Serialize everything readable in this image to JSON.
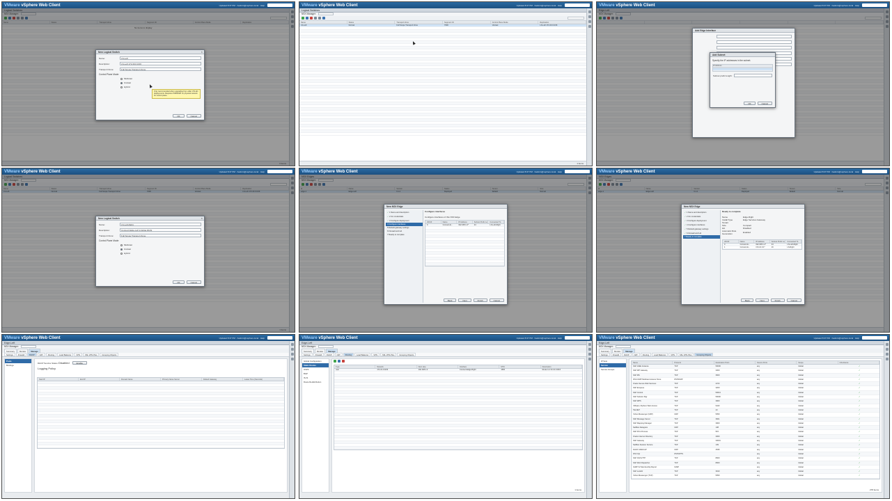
{
  "app": {
    "brand_prefix": "VMware",
    "brand": "vSphere Web Client",
    "topright": "Updated 8:37 PM  ·  hadmin@vsphere.local  ·  Help",
    "nsx_manager_label": "NSX Manager:"
  },
  "panel1": {
    "breadcrumb": "Logical Switches",
    "columns": [
      "Name",
      "Status",
      "Transport Zone",
      "Segment ID",
      "Control Plane Mode",
      "Replication"
    ],
    "empty_text": "No items to display",
    "footer": "0 items",
    "dialog": {
      "title": "New Logical Switch",
      "name_label": "Name:",
      "name_value": "LS-Left",
      "desc_label": "Description:",
      "desc_value": "LS-Left 172.20.0.0/16",
      "tz_label": "Transport Zone:",
      "tz_value": "Full Scope Transport Zone",
      "cpm_label": "Control Plane Mode:",
      "options": [
        "Multicast",
        "Unicast",
        "Hybrid"
      ],
      "tooltip": "Only recommended when upgrading from older VXLAN deployments. Requires PIM/IGMP on physical network for control plane.",
      "ok": "OK",
      "cancel": "Cancel"
    }
  },
  "panel2": {
    "breadcrumb": "Logical Switches",
    "columns": [
      "Name",
      "Status",
      "Transport Zone",
      "Segment ID",
      "Control Plane Mode",
      "Replication"
    ],
    "rows": [
      [
        "LS-Left",
        "Normal",
        "Full Scope Transport Zone",
        "7000",
        "Unicast",
        "LS-Left 172.20.0.0/16"
      ]
    ],
    "footer": "1 items"
  },
  "panel3": {
    "dialog_title": "Add Edge Interface",
    "inner_title": "Add Subnet",
    "inner_text": "Specify the IP addresses in the subnet.",
    "ip_header": "IP Address",
    "ok": "OK",
    "cancel": "Cancel",
    "prefix_label": "Subnet prefix length:",
    "options_text": "Connect Proxy ARP   Send ICMP Redirect"
  },
  "panel4": {
    "breadcrumb": "Logical Switches",
    "rows": [
      [
        "LS-Left",
        "Normal",
        "Full Scope Transport Zone",
        "7000",
        "Unicast",
        "LS-Left 172.20.0.0/16"
      ]
    ],
    "dialog": {
      "title": "New Logical Switch",
      "name_label": "Name:",
      "name_value": "LS-Left-Right",
      "desc_label": "Description:",
      "desc_value": "Connect Edge-Left to Edge-Right",
      "tz_label": "Transport Zone:",
      "tz_value": "Full Scope Transport Zone",
      "cpm_label": "Control Plane Mode:",
      "ok": "OK",
      "cancel": "Cancel"
    },
    "footer": "1 items"
  },
  "panel5": {
    "breadcrumb": "NSX Edges",
    "row": [
      "edge-1",
      "Edge-Left",
      "6.1.2",
      "Deployed",
      "Default",
      "Normal"
    ],
    "wizard_title": "New NSX Edge",
    "steps": [
      "1 Name and description",
      "2 CLI credentials",
      "3 Configure deployment",
      "4 Configure interfaces",
      "5 Default gateway settings",
      "6 Firewall and HA",
      "7 Ready to complete"
    ],
    "section": "Configure interfaces",
    "sub": "Configure interfaces of this NSX Edge",
    "table_cols": [
      "vNIC#",
      "Name",
      "IP Address",
      "Subnet Prefix Length",
      "Connected To"
    ],
    "table_row": [
      "0",
      "Connect-E...",
      "192.168.1.2*",
      "24",
      "LS-Left-Right"
    ],
    "back": "Back",
    "next": "Next",
    "finish": "Finish",
    "cancel": "Cancel"
  },
  "panel6": {
    "breadcrumb": "NSX Edges",
    "wizard_title": "New NSX Edge",
    "section": "Ready to complete",
    "summary": [
      [
        "Name",
        "Edge-Right"
      ],
      [
        "Install Type",
        "Edge Services Gateway"
      ],
      [
        "Tenant",
        ""
      ],
      [
        "Size",
        "Compact"
      ],
      [
        "HA",
        "Disabled"
      ],
      [
        "Automatic Rule Generation",
        "Enabled"
      ]
    ],
    "iface_rows": [
      [
        "0",
        "Connect-E...",
        "192.168.1.2*",
        "24",
        "LS-Left-Right"
      ],
      [
        "1",
        "Connect-E...",
        "172.21.0.1*",
        "16",
        "LS-Right"
      ]
    ],
    "back": "Back",
    "next": "Next",
    "finish": "Finish",
    "cancel": "Cancel"
  },
  "panel7": {
    "title": "Edge-Left",
    "tabs": [
      "Summary",
      "Monitor",
      "Manage"
    ],
    "subtabs": [
      "Settings",
      "Firewall",
      "DHCP",
      "NAT",
      "Routing",
      "Load Balancer",
      "VPN",
      "SSL VPN-Plus",
      "Grouping Objects"
    ],
    "nav": [
      "Pools",
      "Bindings"
    ],
    "dhcp_label": "DHCP Service Status:",
    "dhcp_value": "Disabled",
    "enable": "Enable",
    "logging": "Logging Policy",
    "columns": [
      "Start IP",
      "End IP",
      "Domain Name",
      "Primary Name Server",
      "Default Gateway",
      "Lease Time (Seconds)"
    ]
  },
  "panel8": {
    "title": "Edge-Left",
    "tabs": [
      "Summary",
      "Monitor",
      "Manage"
    ],
    "subtabs": [
      "Settings",
      "Firewall",
      "DHCP",
      "NAT",
      "Routing",
      "Load Balancer",
      "VPN",
      "SSL VPN-Plus",
      "Grouping Objects"
    ],
    "nav": [
      "Global Configuration",
      "Static Routes",
      "OSPF",
      "BGP",
      "IS-IS",
      "Route Redistribution"
    ],
    "columns": [
      "Type",
      "Network",
      "Next Hop",
      "Interface",
      "MTU",
      "Description"
    ],
    "row": [
      "user",
      "172.21.0.0/16",
      "192.168.1.2",
      "Connect-Edge-Right",
      "1500",
      "Route to 172.21.0.0/16"
    ],
    "footer": "1 items"
  },
  "panel9": {
    "title": "Edge-Left",
    "tabs": [
      "Summary",
      "Monitor",
      "Manage"
    ],
    "subtabs": [
      "Settings",
      "Firewall",
      "DHCP",
      "NAT",
      "Routing",
      "Load Balancer",
      "VPN",
      "SSL VPN-Plus",
      "Grouping Objects"
    ],
    "nav": [
      "IP Sets",
      "Service",
      "Service Groups"
    ],
    "columns": [
      "Name",
      "Protocol",
      "Destination Ports",
      "Source Ports",
      "Scope",
      "Inheritance"
    ],
    "rows": [
      [
        "SAP J2EE Instance",
        "TCP",
        "50000"
      ],
      [
        "SAP WP Gateway",
        "TCP",
        "3300"
      ],
      [
        "SAP MS",
        "TCP",
        "3600"
      ],
      [
        "IPv6-ICMP Multicast Listener Done",
        "IPV6ICMP",
        ""
      ],
      [
        "Oracle Secure Web Services",
        "TCP",
        "2372"
      ],
      [
        "SAP Enqueue",
        "TCP",
        "3200"
      ],
      [
        "SAP Control",
        "TCP",
        "50013"
      ],
      [
        "SAP Solution Mgr",
        "TCP",
        "50000"
      ],
      [
        "SAP WPS",
        "TCP",
        "3900"
      ],
      [
        "VMware vSphere Web Access",
        "TCP",
        "9443"
      ],
      [
        "TELNET",
        "TCP",
        "23"
      ],
      [
        "Yahoo Messenger (UDP)",
        "UDP",
        "5050"
      ],
      [
        "SAP Message Server",
        "TCP",
        "3601"
      ],
      [
        "SAP Mapping Manager",
        "TCP",
        "3900"
      ],
      [
        "NetBios Datagram",
        "UDP",
        "138"
      ],
      [
        "SAP Print Process",
        "TCP",
        "515"
      ],
      [
        "Oracle Internet Directory",
        "TCP",
        "3060"
      ],
      [
        "SAP Gateway",
        "TCP",
        "33001"
      ],
      [
        "NetBios Session Service",
        "TCP",
        "139"
      ],
      [
        "DHCP, MADCAP",
        "UDP",
        "2535"
      ],
      [
        "IPv6 Opt",
        "IPV6OPTS",
        ""
      ],
      [
        "SAP ICM HTTP",
        "TCP",
        "8000"
      ],
      [
        "SAP Web Dispatcher",
        "TCP",
        "8000"
      ],
      [
        "IGMP V2 Membership Report",
        "IGMP",
        ""
      ],
      [
        "SAP Lockdir",
        "TCP",
        "3910"
      ],
      [
        "Yahoo Messenger (TCP)",
        "TCP",
        "5050"
      ]
    ],
    "scope": "Global",
    "inheritance": "✓",
    "footer": "278 items"
  }
}
